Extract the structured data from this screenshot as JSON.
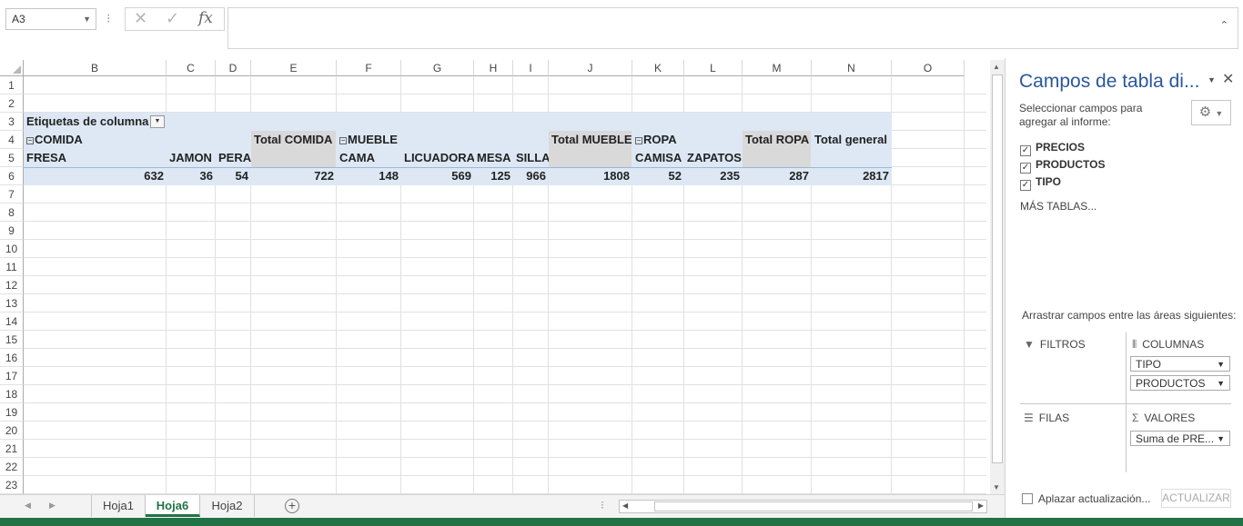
{
  "formula_bar": {
    "name_box": "A3",
    "formula": ""
  },
  "columns": [
    "B",
    "C",
    "D",
    "E",
    "F",
    "G",
    "H",
    "I",
    "J",
    "K",
    "L",
    "M",
    "N",
    "O"
  ],
  "rows": [
    "1",
    "2",
    "3",
    "4",
    "5",
    "6",
    "7",
    "8",
    "9",
    "10",
    "11",
    "12",
    "13",
    "14",
    "15",
    "16",
    "17",
    "18",
    "19",
    "20",
    "21",
    "22",
    "23"
  ],
  "pivot": {
    "header_label": "Etiquetas de columna",
    "groups": {
      "comida": "COMIDA",
      "mueble": "MUEBLE",
      "ropa": "ROPA"
    },
    "totals": {
      "comida": "Total COMIDA",
      "mueble": "Total MUEBLE",
      "ropa": "Total ROPA",
      "general": "Total general"
    },
    "items": {
      "fresa": "FRESA",
      "jamon": "JAMON",
      "pera": "PERA",
      "cama": "CAMA",
      "licuadora": "LICUADORA",
      "mesa": "MESA",
      "silla": "SILLA",
      "camisa": "CAMISA",
      "zapatos": "ZAPATOS"
    },
    "values": {
      "fresa": "632",
      "jamon": "36",
      "pera": "54",
      "total_comida": "722",
      "cama": "148",
      "licuadora": "569",
      "mesa": "125",
      "silla": "966",
      "total_mueble": "1808",
      "camisa": "52",
      "zapatos": "235",
      "total_ropa": "287",
      "total_general": "2817"
    }
  },
  "sheet_tabs": [
    "Hoja1",
    "Hoja6",
    "Hoja2"
  ],
  "active_tab": "Hoja6",
  "pane": {
    "title": "Campos de tabla di...",
    "instruction": "Seleccionar campos para agregar al informe:",
    "fields": [
      {
        "label": "PRECIOS",
        "checked": true
      },
      {
        "label": "PRODUCTOS",
        "checked": true
      },
      {
        "label": "TIPO",
        "checked": true
      }
    ],
    "more_tables": "MÁS TABLAS...",
    "drag_instruction": "Arrastrar campos entre las áreas siguientes:",
    "areas": {
      "filters": "FILTROS",
      "columns": "COLUMNAS",
      "rows": "FILAS",
      "values": "VALORES"
    },
    "column_chips": [
      "TIPO",
      "PRODUCTOS"
    ],
    "value_chips": [
      "Suma de PRE..."
    ],
    "defer_label": "Aplazar actualización...",
    "update_label": "ACTUALIZAR"
  },
  "colors": {
    "accent": "#217346",
    "pivot_band": "#dde8f4",
    "total_fill": "#d9d9d9",
    "pane_title": "#2b579a"
  }
}
